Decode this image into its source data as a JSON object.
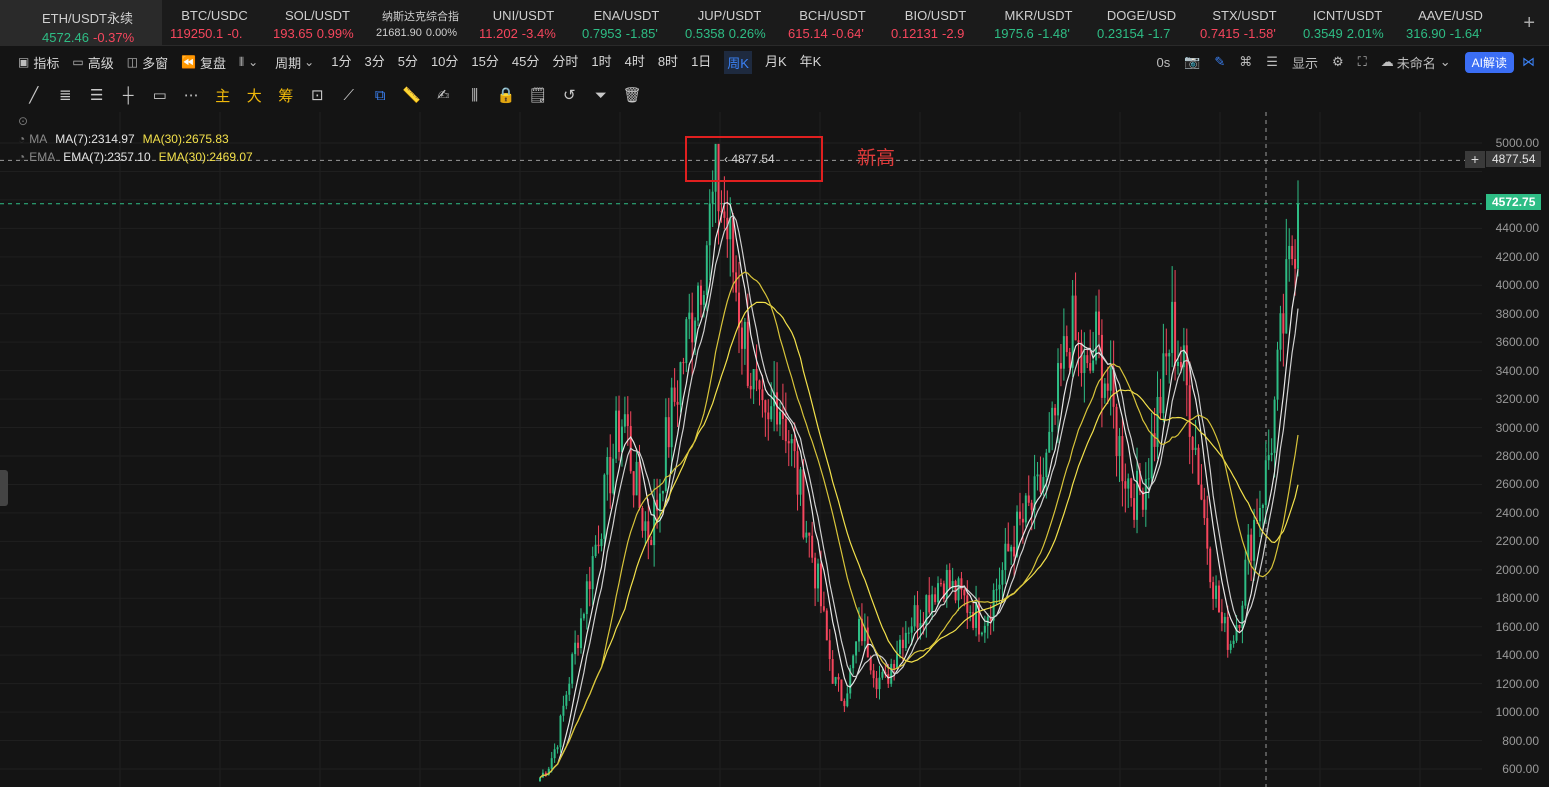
{
  "tickers": [
    {
      "symbol": "ETH/USDT永续",
      "price": "4572.46",
      "change": "-0.37%",
      "price_dir": "up",
      "change_dir": "down",
      "active": true
    },
    {
      "symbol": "BTC/USDC",
      "price": "119250.1",
      "change": "-0.",
      "price_dir": "down",
      "change_dir": "down"
    },
    {
      "symbol": "SOL/USDT",
      "price": "193.65",
      "change": "0.99%",
      "price_dir": "down",
      "change_dir": "down"
    },
    {
      "symbol": "纳斯达克综合指",
      "price": "21681.90",
      "change": "0.00%",
      "price_dir": "neutral",
      "change_dir": "neutral",
      "small": true
    },
    {
      "symbol": "UNI/USDT",
      "price": "11.202",
      "change": "-3.4%",
      "price_dir": "down",
      "change_dir": "down"
    },
    {
      "symbol": "ENA/USDT",
      "price": "0.7953",
      "change": "-1.85'",
      "price_dir": "up",
      "change_dir": "up"
    },
    {
      "symbol": "JUP/USDT",
      "price": "0.5358",
      "change": "0.26%",
      "price_dir": "up",
      "change_dir": "up"
    },
    {
      "symbol": "BCH/USDT",
      "price": "615.14",
      "change": "-0.64'",
      "price_dir": "down",
      "change_dir": "down"
    },
    {
      "symbol": "BIO/USDT",
      "price": "0.12131",
      "change": "-2.9",
      "price_dir": "down",
      "change_dir": "down"
    },
    {
      "symbol": "MKR/USDT",
      "price": "1975.6",
      "change": "-1.48'",
      "price_dir": "up",
      "change_dir": "up"
    },
    {
      "symbol": "DOGE/USD",
      "price": "0.23154",
      "change": "-1.7",
      "price_dir": "up",
      "change_dir": "up"
    },
    {
      "symbol": "STX/USDT",
      "price": "0.7415",
      "change": "-1.58'",
      "price_dir": "down",
      "change_dir": "down"
    },
    {
      "symbol": "ICNT/USDT",
      "price": "0.3549",
      "change": "2.01%",
      "price_dir": "up",
      "change_dir": "up"
    },
    {
      "symbol": "AAVE/USD",
      "price": "316.90",
      "change": "-1.64'",
      "price_dir": "up",
      "change_dir": "up"
    }
  ],
  "toolbar": {
    "indicators": "指标",
    "advanced": "高级",
    "multi_window": "多窗",
    "replay": "复盘",
    "period": "周期",
    "periods": [
      "1分",
      "3分",
      "5分",
      "10分",
      "15分",
      "45分",
      "分时",
      "1时",
      "4时",
      "8时",
      "1日",
      "周K",
      "月K",
      "年K"
    ],
    "active_period": "周K",
    "countdown": "0s",
    "display": "显示",
    "layout_name": "未命名",
    "ai_button": "AI解读"
  },
  "drawing_tools": {
    "main": "主",
    "big": "大",
    "chips": "筹"
  },
  "legend": {
    "ma_label": "MA",
    "ma7": "MA(7):2314.97",
    "ma30": "MA(30):2675.83",
    "ema_label": "EMA",
    "ema7": "EMA(7):2357.10",
    "ema30": "EMA(30):2469.07"
  },
  "annotation": {
    "text": "新高",
    "high_value": "4877.54"
  },
  "price_labels": {
    "high": "4877.54",
    "current": "4572.75"
  },
  "colors": {
    "up": "#2ebd85",
    "down": "#f6465d",
    "ma7": "#e8e8e8",
    "ma30": "#f3e14b",
    "accent": "#3b82f6",
    "annotation": "#e01f1f"
  },
  "chart_data": {
    "type": "candlestick",
    "symbol": "ETH/USDT永续",
    "interval": "周K",
    "ylim": [
      500,
      5150
    ],
    "y_ticks": [
      600,
      800,
      1000,
      1200,
      1400,
      1600,
      1800,
      2000,
      2200,
      2400,
      2600,
      2800,
      3000,
      3200,
      3400,
      3600,
      3800,
      4000,
      4200,
      4400,
      4600,
      4800,
      5000
    ],
    "y_tick_labels": [
      "600.00",
      "800.00",
      "1000.00",
      "1200.00",
      "1400.00",
      "1600.00",
      "1800.00",
      "2000.00",
      "2200.00",
      "2400.00",
      "2600.00",
      "2800.00",
      "3000.00",
      "3200.00",
      "3400.00",
      "3600.00",
      "3800.00",
      "4000.00",
      "4200.00",
      "4400.00",
      "4600.00",
      "4800.00",
      "5000.00"
    ],
    "close_path": [
      540,
      620,
      780,
      1100,
      1400,
      1700,
      2000,
      2300,
      2600,
      2900,
      3100,
      2700,
      2400,
      2250,
      2500,
      2900,
      3200,
      3500,
      3800,
      4100,
      4400,
      4700,
      4450,
      4100,
      3700,
      3400,
      3050,
      2900,
      3300,
      3100,
      2800,
      2500,
      2200,
      1900,
      1500,
      1200,
      1100,
      1300,
      1600,
      1450,
      1250,
      1200,
      1400,
      1550,
      1650,
      1700,
      1800,
      1900,
      1950,
      1850,
      1800,
      1750,
      1650,
      1700,
      1850,
      2000,
      2200,
      2300,
      2400,
      2500,
      2700,
      3000,
      3400,
      3700,
      3500,
      3300,
      3600,
      3400,
      3100,
      2800,
      2600,
      2500,
      2700,
      3000,
      3300,
      3700,
      3500,
      3200,
      2800,
      2300,
      1900,
      1600,
      1500,
      1700,
      2100,
      2400,
      2600,
      3000,
      3600,
      4100,
      4572
    ],
    "x_start_frac": 0.35,
    "x_end_frac": 0.84
  }
}
